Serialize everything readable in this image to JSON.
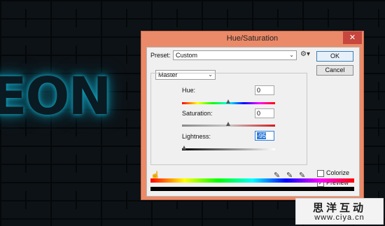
{
  "background": {
    "text": "EON",
    "glow_color": "#14a7c4"
  },
  "watermark": {
    "line1": "思洋互动",
    "line2": "www.ciya.cn"
  },
  "dialog": {
    "title": "Hue/Saturation",
    "close_glyph": "✕",
    "preset_label": "Preset:",
    "preset_value": "Custom",
    "ok_label": "OK",
    "cancel_label": "Cancel",
    "channel_value": "Master",
    "hue_label": "Hue:",
    "hue_value": "0",
    "saturation_label": "Saturation:",
    "saturation_value": "0",
    "lightness_label": "Lightness:",
    "lightness_value": "-95",
    "lightness_level": -95,
    "colorize_label": "Colorize",
    "colorize_checked": false,
    "preview_label": "Preview",
    "preview_checked": true,
    "accent_color": "#eb8a68",
    "close_color": "#c7463e"
  }
}
